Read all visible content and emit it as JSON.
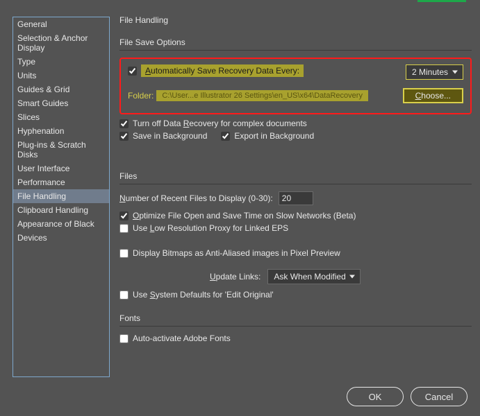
{
  "sidebar": {
    "items": [
      {
        "label": "General"
      },
      {
        "label": "Selection & Anchor Display"
      },
      {
        "label": "Type"
      },
      {
        "label": "Units"
      },
      {
        "label": "Guides & Grid"
      },
      {
        "label": "Smart Guides"
      },
      {
        "label": "Slices"
      },
      {
        "label": "Hyphenation"
      },
      {
        "label": "Plug-ins & Scratch Disks"
      },
      {
        "label": "User Interface"
      },
      {
        "label": "Performance"
      },
      {
        "label": "File Handling"
      },
      {
        "label": "Clipboard Handling"
      },
      {
        "label": "Appearance of Black"
      },
      {
        "label": "Devices"
      }
    ],
    "activeIndex": 11
  },
  "page": {
    "title": "File Handling"
  },
  "fileSaveOptions": {
    "legend": "File Save Options",
    "autoSaveLabel": "Automatically Save Recovery Data Every:",
    "autoSaveChecked": true,
    "intervalValue": "2 Minutes",
    "folderLabel": "Folder:",
    "folderPath": "C:\\User...e Illustrator 26 Settings\\en_US\\x64\\DataRecovery",
    "chooseLabel": "Choose...",
    "turnOffLabel": "Turn off Data Recovery for complex documents",
    "turnOffChecked": true,
    "saveBgLabel": "Save in Background",
    "saveBgChecked": true,
    "exportBgLabel": "Export in Background",
    "exportBgChecked": true
  },
  "files": {
    "legend": "Files",
    "recentLabel": "Number of Recent Files to Display (0-30):",
    "recentValue": "20",
    "optimizeLabel": "Optimize File Open and Save Time on Slow Networks (Beta)",
    "optimizeChecked": true,
    "lowResLabel": "Use Low Resolution Proxy for Linked EPS",
    "lowResChecked": false,
    "bitmapsLabel": "Display Bitmaps as Anti-Aliased images in Pixel Preview",
    "bitmapsChecked": false,
    "updateLinksLabel": "Update Links:",
    "updateLinksValue": "Ask When Modified",
    "sysDefaultsLabel": "Use System Defaults for 'Edit Original'",
    "sysDefaultsChecked": false
  },
  "fonts": {
    "legend": "Fonts",
    "autoActivateLabel": "Auto-activate Adobe Fonts",
    "autoActivateChecked": false
  },
  "footer": {
    "ok": "OK",
    "cancel": "Cancel"
  }
}
